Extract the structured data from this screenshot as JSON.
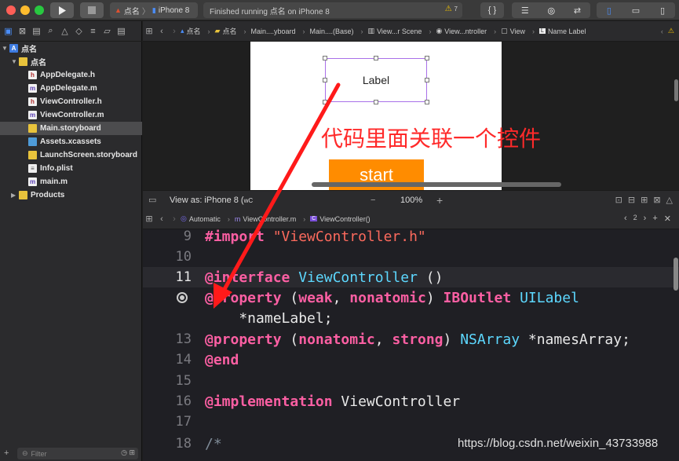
{
  "toolbar": {
    "scheme_project": "点名",
    "scheme_device": "iPhone 8",
    "status_text": "Finished running 点名 on iPhone 8",
    "warning_count": "7",
    "run_icon": "play-icon",
    "stop_icon": "stop-icon"
  },
  "navigator": {
    "items": [
      {
        "label": "点名",
        "icon": "project-icon",
        "level": 0,
        "expanded": true
      },
      {
        "label": "点名",
        "icon": "folder-icon",
        "level": 1,
        "expanded": true
      },
      {
        "label": "AppDelegate.h",
        "icon": "h-file-icon",
        "level": 2
      },
      {
        "label": "AppDelegate.m",
        "icon": "m-file-icon",
        "level": 2
      },
      {
        "label": "ViewController.h",
        "icon": "h-file-icon",
        "level": 2
      },
      {
        "label": "ViewController.m",
        "icon": "m-file-icon",
        "level": 2
      },
      {
        "label": "Main.storyboard",
        "icon": "storyboard-icon",
        "level": 2,
        "selected": true
      },
      {
        "label": "Assets.xcassets",
        "icon": "assets-icon",
        "level": 2
      },
      {
        "label": "LaunchScreen.storyboard",
        "icon": "storyboard-icon",
        "level": 2
      },
      {
        "label": "Info.plist",
        "icon": "plist-icon",
        "level": 2
      },
      {
        "label": "main.m",
        "icon": "m-file-icon",
        "level": 2
      },
      {
        "label": "Products",
        "icon": "folder-icon",
        "level": 1,
        "expanded": false
      }
    ],
    "filter_placeholder": "Filter"
  },
  "storyboard_jumpbar": {
    "crumbs": [
      "点名",
      "点名",
      "Main....yboard",
      "Main....(Base)",
      "View...r Scene",
      "View...ntroller",
      "View",
      "Name Label"
    ]
  },
  "canvas": {
    "label_text": "Label",
    "start_button": "start",
    "annotation": "代码里面关联一个控件"
  },
  "canvas_bar": {
    "view_as": "View as: iPhone 8 (",
    "view_as_suffix": "wC",
    "zoom_minus": "−",
    "zoom": "100%",
    "zoom_plus": "+"
  },
  "editor_jumpbar": {
    "mode": "Automatic",
    "file": "ViewController.m",
    "symbol": "ViewController()",
    "counter": "2"
  },
  "code": [
    {
      "line": "9",
      "parts": [
        {
          "t": "#import ",
          "c": "kw"
        },
        {
          "t": "\"ViewController.h\"",
          "c": "str"
        }
      ]
    },
    {
      "line": "10",
      "parts": []
    },
    {
      "line": "11",
      "current": true,
      "parts": [
        {
          "t": "@interface ",
          "c": "kw"
        },
        {
          "t": "ViewController",
          "c": "cls"
        },
        {
          "t": " ()",
          "c": ""
        }
      ]
    },
    {
      "line": "",
      "outlet": true,
      "parts": [
        {
          "t": "@property",
          "c": "kw"
        },
        {
          "t": " (",
          "c": ""
        },
        {
          "t": "weak",
          "c": "kw"
        },
        {
          "t": ", ",
          "c": ""
        },
        {
          "t": "nonatomic",
          "c": "kw"
        },
        {
          "t": ") ",
          "c": ""
        },
        {
          "t": "IBOutlet",
          "c": "kw"
        },
        {
          "t": " ",
          "c": ""
        },
        {
          "t": "UILabel",
          "c": "cls"
        }
      ]
    },
    {
      "line": "",
      "parts": [
        {
          "t": "    *nameLabel;",
          "c": ""
        }
      ]
    },
    {
      "line": "13",
      "parts": [
        {
          "t": "@property",
          "c": "kw"
        },
        {
          "t": " (",
          "c": ""
        },
        {
          "t": "nonatomic",
          "c": "kw"
        },
        {
          "t": ", ",
          "c": ""
        },
        {
          "t": "strong",
          "c": "kw"
        },
        {
          "t": ") ",
          "c": ""
        },
        {
          "t": "NSArray",
          "c": "cls"
        },
        {
          "t": " *namesArray;",
          "c": ""
        }
      ]
    },
    {
      "line": "14",
      "parts": [
        {
          "t": "@end",
          "c": "kw"
        }
      ]
    },
    {
      "line": "15",
      "parts": []
    },
    {
      "line": "16",
      "parts": [
        {
          "t": "@implementation",
          "c": "kw"
        },
        {
          "t": " ViewController",
          "c": ""
        }
      ]
    },
    {
      "line": "17",
      "parts": []
    },
    {
      "line": "18",
      "parts": [
        {
          "t": "/*",
          "c": "cmt"
        }
      ]
    }
  ],
  "watermark": "https://blog.csdn.net/weixin_43733988"
}
